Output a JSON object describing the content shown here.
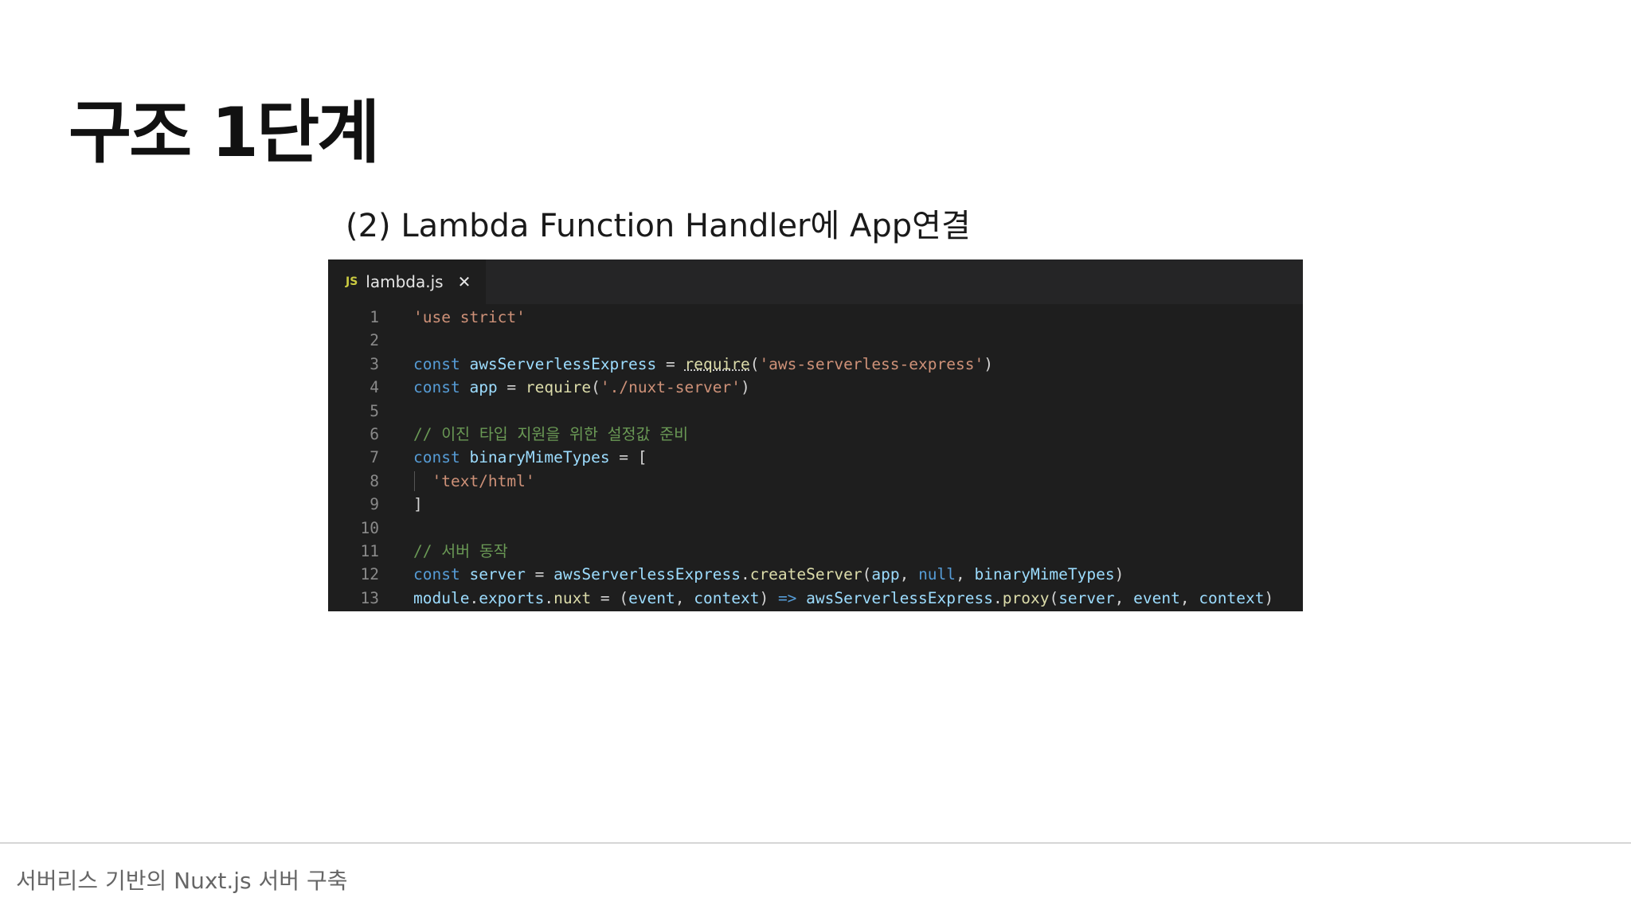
{
  "slide": {
    "title": "구조 1단계",
    "subtitle": "(2) Lambda Function Handler에 App연결",
    "footer": "서버리스 기반의 Nuxt.js 서버 구축"
  },
  "editor": {
    "tab": {
      "icon": "JS",
      "filename": "lambda.js",
      "close_icon": "✕"
    },
    "line_numbers": [
      "1",
      "2",
      "3",
      "4",
      "5",
      "6",
      "7",
      "8",
      "9",
      "10",
      "11",
      "12",
      "13"
    ],
    "lines": [
      [
        {
          "t": "'use strict'",
          "c": "str"
        }
      ],
      [],
      [
        {
          "t": "const ",
          "c": "kw"
        },
        {
          "t": "awsServerlessExpress",
          "c": "var"
        },
        {
          "t": " = ",
          "c": "plain"
        },
        {
          "t": "require",
          "c": "req"
        },
        {
          "t": "(",
          "c": "plain"
        },
        {
          "t": "'aws-serverless-express'",
          "c": "str"
        },
        {
          "t": ")",
          "c": "plain"
        }
      ],
      [
        {
          "t": "const ",
          "c": "kw"
        },
        {
          "t": "app",
          "c": "var"
        },
        {
          "t": " = ",
          "c": "plain"
        },
        {
          "t": "require",
          "c": "fn"
        },
        {
          "t": "(",
          "c": "plain"
        },
        {
          "t": "'./nuxt-server'",
          "c": "str"
        },
        {
          "t": ")",
          "c": "plain"
        }
      ],
      [],
      [
        {
          "t": "// 이진 타입 지원을 위한 설정값 준비",
          "c": "cm"
        }
      ],
      [
        {
          "t": "const ",
          "c": "kw"
        },
        {
          "t": "binaryMimeTypes",
          "c": "var"
        },
        {
          "t": " = [",
          "c": "plain"
        }
      ],
      [
        {
          "t": "  ",
          "c": "plain"
        },
        {
          "t": "'text/html'",
          "c": "str"
        }
      ],
      [
        {
          "t": "]",
          "c": "plain"
        }
      ],
      [],
      [
        {
          "t": "// 서버 동작",
          "c": "cm"
        }
      ],
      [
        {
          "t": "const ",
          "c": "kw"
        },
        {
          "t": "server",
          "c": "var"
        },
        {
          "t": " = ",
          "c": "plain"
        },
        {
          "t": "awsServerlessExpress",
          "c": "var"
        },
        {
          "t": ".",
          "c": "plain"
        },
        {
          "t": "createServer",
          "c": "fn"
        },
        {
          "t": "(",
          "c": "plain"
        },
        {
          "t": "app",
          "c": "var"
        },
        {
          "t": ", ",
          "c": "plain"
        },
        {
          "t": "null",
          "c": "kw"
        },
        {
          "t": ", ",
          "c": "plain"
        },
        {
          "t": "binaryMimeTypes",
          "c": "var"
        },
        {
          "t": ")",
          "c": "plain"
        }
      ],
      [
        {
          "t": "module",
          "c": "var"
        },
        {
          "t": ".",
          "c": "plain"
        },
        {
          "t": "exports",
          "c": "var"
        },
        {
          "t": ".",
          "c": "plain"
        },
        {
          "t": "nuxt",
          "c": "fn"
        },
        {
          "t": " = (",
          "c": "plain"
        },
        {
          "t": "event",
          "c": "var"
        },
        {
          "t": ", ",
          "c": "plain"
        },
        {
          "t": "context",
          "c": "var"
        },
        {
          "t": ") ",
          "c": "plain"
        },
        {
          "t": "=>",
          "c": "kw"
        },
        {
          "t": " ",
          "c": "plain"
        },
        {
          "t": "awsServerlessExpress",
          "c": "var"
        },
        {
          "t": ".",
          "c": "plain"
        },
        {
          "t": "proxy",
          "c": "fn"
        },
        {
          "t": "(",
          "c": "plain"
        },
        {
          "t": "server",
          "c": "var"
        },
        {
          "t": ", ",
          "c": "plain"
        },
        {
          "t": "event",
          "c": "var"
        },
        {
          "t": ", ",
          "c": "plain"
        },
        {
          "t": "context",
          "c": "var"
        },
        {
          "t": ")",
          "c": "plain"
        }
      ]
    ]
  },
  "colors": {
    "editor_background": "#1e1e1e",
    "tab_bar_background": "#252526",
    "keyword": "#569cd6",
    "string": "#ce9178",
    "comment": "#6a9955",
    "function": "#dcdcaa",
    "variable": "#9cdcfe",
    "js_icon": "#cbcb41"
  }
}
